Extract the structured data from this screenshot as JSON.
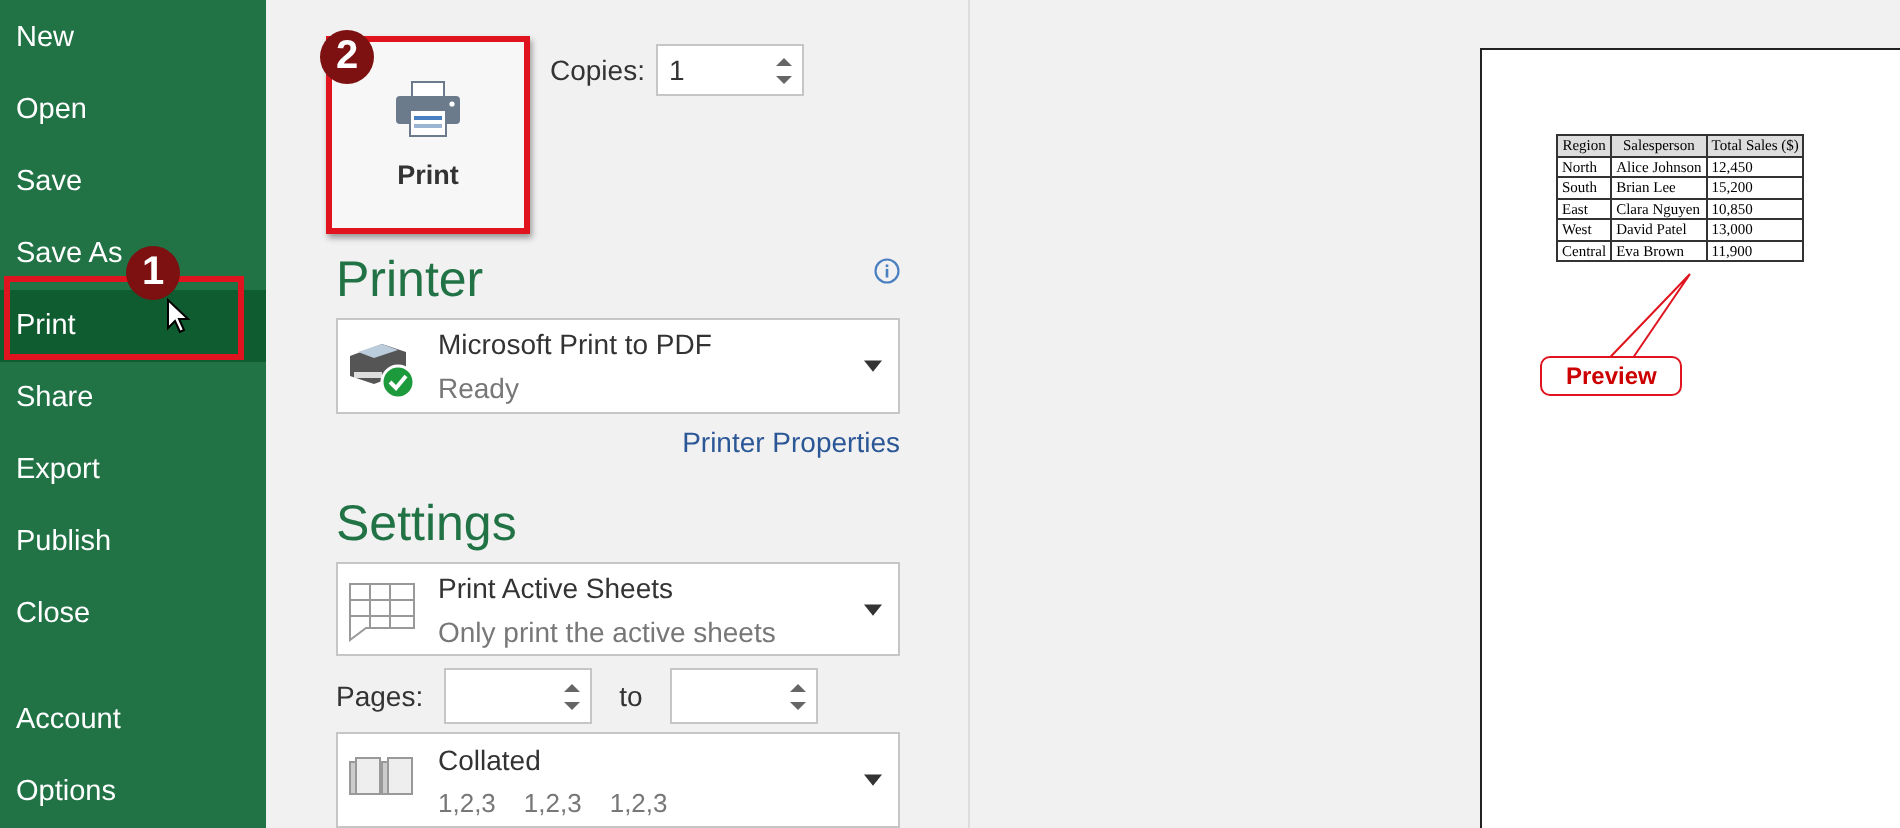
{
  "sidebar": {
    "items": [
      {
        "label": "New",
        "selected": false
      },
      {
        "label": "Open",
        "selected": false
      },
      {
        "label": "Save",
        "selected": false
      },
      {
        "label": "Save As",
        "selected": false
      },
      {
        "label": "Print",
        "selected": true
      },
      {
        "label": "Share",
        "selected": false
      },
      {
        "label": "Export",
        "selected": false
      },
      {
        "label": "Publish",
        "selected": false
      },
      {
        "label": "Close",
        "selected": false
      }
    ],
    "footer_items": [
      {
        "label": "Account",
        "selected": false
      },
      {
        "label": "Options",
        "selected": false
      }
    ],
    "step_badge": "1"
  },
  "print_button": {
    "label": "Print",
    "step_badge": "2"
  },
  "copies": {
    "label": "Copies:",
    "value": "1"
  },
  "printer": {
    "heading": "Printer",
    "name": "Microsoft Print to PDF",
    "status": "Ready",
    "properties_link": "Printer Properties"
  },
  "settings": {
    "heading": "Settings",
    "what": {
      "title": "Print Active Sheets",
      "subtitle": "Only print the active sheets"
    },
    "pages": {
      "label": "Pages:",
      "to": "to"
    },
    "collation": {
      "title": "Collated",
      "subtitle": [
        "1,2,3",
        "1,2,3",
        "1,2,3"
      ]
    }
  },
  "preview": {
    "table": {
      "columns": [
        "Region",
        "Salesperson",
        "Total Sales ($)"
      ],
      "rows": [
        [
          "North",
          "Alice Johnson",
          "12,450"
        ],
        [
          "South",
          "Brian Lee",
          "15,200"
        ],
        [
          "East",
          "Clara Nguyen",
          "10,850"
        ],
        [
          "West",
          "David Patel",
          "13,000"
        ],
        [
          "Central",
          "Eva Brown",
          "11,900"
        ]
      ]
    },
    "callout": "Preview"
  }
}
